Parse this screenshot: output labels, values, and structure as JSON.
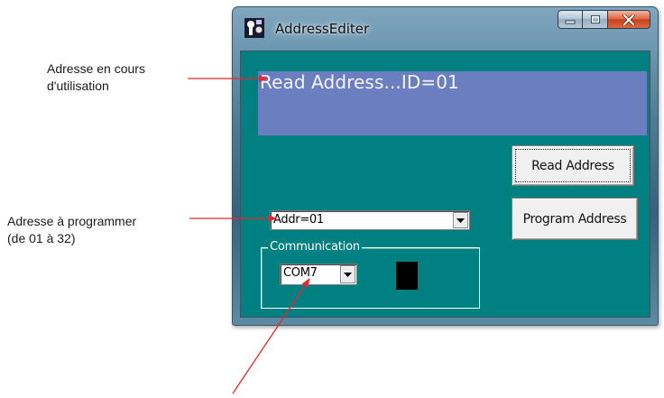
{
  "annotations": {
    "current_address": [
      "Adresse en cours",
      "d'utilisation"
    ],
    "address_to_program": [
      "Adresse à programmer",
      "(de 01 à 32)"
    ]
  },
  "window": {
    "title": "AddressEditer"
  },
  "display": {
    "text": "Read Address...ID=01"
  },
  "buttons": {
    "read": "Read Address",
    "program": "Program Address"
  },
  "address_combo": {
    "value": "Addr=01"
  },
  "communication": {
    "label": "Communication",
    "port": "COM7"
  },
  "colors": {
    "client_bg": "#008080",
    "display_bg": "#6b7fc0",
    "arrow": "#e8262c",
    "indicator": "#000000"
  }
}
